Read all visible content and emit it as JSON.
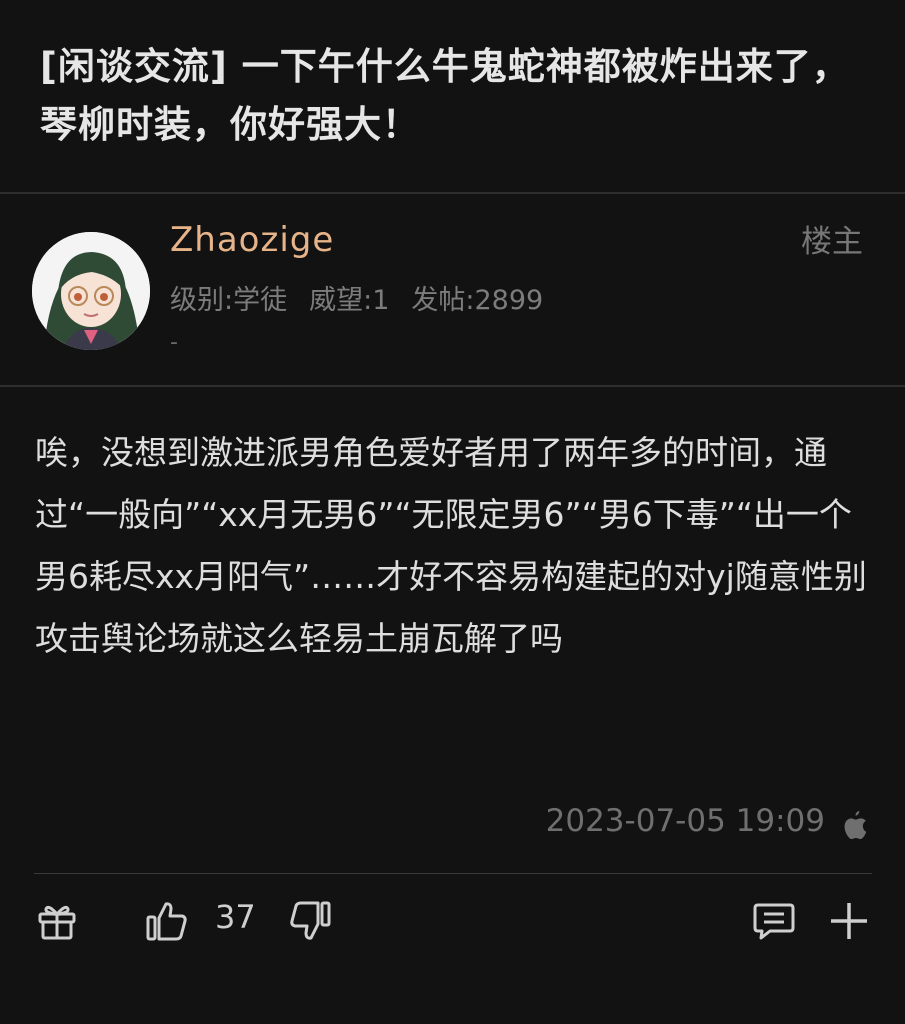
{
  "post": {
    "title": "[闲谈交流] 一下午什么牛鬼蛇神都被炸出来了，琴柳时装，你好强大！"
  },
  "author": {
    "username": "Zhaozige",
    "level": "级别:学徒",
    "prestige": "威望:1",
    "posts": "发帖:2899",
    "signature": "-",
    "tag": "楼主"
  },
  "body": {
    "text": "唉，没想到激进派男角色爱好者用了两年多的时间，通过“一般向”“xx月无男6”“无限定男6”“男6下毒”“出一个男6耗尽xx月阳气”……才好不容易构建起的对yj随意性别攻击舆论场就这么轻易土崩瓦解了吗"
  },
  "timestamp": "2023-07-05 19:09",
  "footer": {
    "likes": "37",
    "icons": [
      "gift-icon",
      "thumbs-up-icon",
      "thumbs-down-icon",
      "comment-icon",
      "plus-icon"
    ]
  },
  "colors": {
    "background": "#121212",
    "username": "#e7b48a"
  }
}
